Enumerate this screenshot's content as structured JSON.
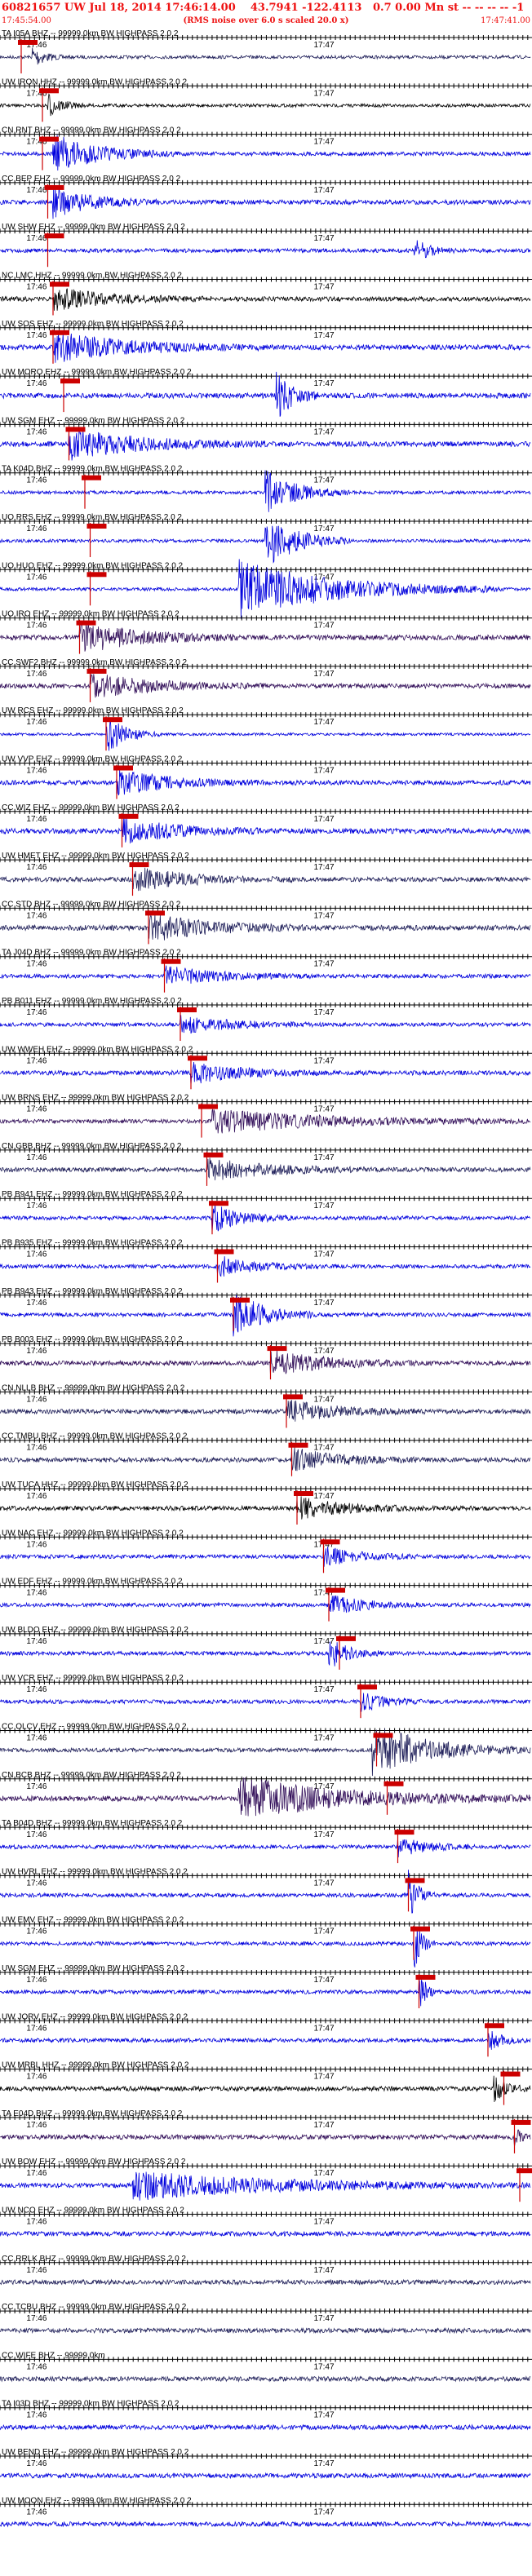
{
  "header": {
    "title": "60821657 UW Jul 18, 2014 17:46:14.00    43.7941 -122.4113   0.7 0.00 Mn st -- -- -- -- -1",
    "subtitle": "(RMS noise over 6.0 s scaled 20.0 x)",
    "start_time": "17:45:54.00",
    "end_time": "17:47:41.00"
  },
  "tick_labels": {
    "a": "17:46",
    "b": "17:47"
  },
  "colors": {
    "blue": "#0000dd",
    "navy": "#20205a",
    "black": "#000000",
    "purple": "#33105a",
    "pick": "#cc0000",
    "bg": "#ffffff"
  },
  "chart_data": {
    "type": "seismogram",
    "x_range": [
      "17:45:54.00",
      "17:47:41.00"
    ],
    "traces": [
      {
        "label": "TA I05A BHZ -- 99999.0km BW HIGHPASS 2.0 2",
        "color": "navy",
        "amp": 0.5,
        "pick": 0.04,
        "burst": [
          0.06,
          0.12,
          2.0
        ]
      },
      {
        "label": "UW IRON HHZ -- 99999.0km BW HIGHPASS 2.0 2",
        "color": "black",
        "amp": 0.5,
        "pick": 0.08,
        "burst": [
          0.09,
          0.16,
          2.0
        ]
      },
      {
        "label": "CN RNT BHZ -- 99999.0km BW HIGHPASS 2.0 2",
        "color": "blue",
        "amp": 0.6,
        "pick": 0.08,
        "burst": [
          0.1,
          0.34,
          2.5
        ]
      },
      {
        "label": "CC BEP EHZ -- 99999.0km BW HIGHPASS 2.0 2",
        "color": "blue",
        "amp": 0.7,
        "pick": 0.09,
        "burst": [
          0.1,
          0.3,
          1.6
        ]
      },
      {
        "label": "UW SHW EHZ -- 99999.0km BW HIGHPASS 2.0 2",
        "color": "blue",
        "amp": 0.6,
        "pick": 0.09,
        "burst": [
          0.78,
          0.86,
          1.6
        ]
      },
      {
        "label": "NC LMC HHZ -- 99999.0km BW HIGHPASS 2.0 2",
        "color": "black",
        "amp": 0.7,
        "pick": 0.1,
        "burst": [
          0.1,
          0.4,
          1.2
        ]
      },
      {
        "label": "UW SOS EHZ -- 99999.0km BW HIGHPASS 2.0 2",
        "color": "blue",
        "amp": 0.8,
        "pick": 0.1,
        "burst": [
          0.1,
          0.5,
          1.4
        ]
      },
      {
        "label": "UW MORO EHZ -- 99999.0km BW HIGHPASS 2.0 2",
        "color": "blue",
        "amp": 0.8,
        "pick": 0.12,
        "burst": [
          0.52,
          0.6,
          2.5
        ]
      },
      {
        "label": "UW SGM EHZ -- 99999.0km BW HIGHPASS 2.0 2",
        "color": "blue",
        "amp": 0.8,
        "pick": 0.13,
        "burst": [
          0.13,
          0.5,
          1.4
        ]
      },
      {
        "label": "TA K04D BHZ -- 99999.0km BW HIGHPASS 2.0 2",
        "color": "blue",
        "amp": 0.5,
        "pick": 0.16,
        "burst": [
          0.5,
          0.66,
          3.5
        ]
      },
      {
        "label": "UO RRS EHZ -- 99999.0km BW HIGHPASS 2.0 2",
        "color": "blue",
        "amp": 0.5,
        "pick": 0.17,
        "burst": [
          0.5,
          0.66,
          4.5
        ]
      },
      {
        "label": "UO HUO EHZ -- 99999.0km BW HIGHPASS 2.0 2",
        "color": "blue",
        "amp": 0.5,
        "pick": 0.17,
        "burst": [
          0.45,
          0.95,
          4.5
        ]
      },
      {
        "label": "UO IRO EHZ -- 99999.0km BW HIGHPASS 2.0 2",
        "color": "purple",
        "amp": 0.8,
        "pick": 0.15,
        "burst": [
          0.15,
          0.45,
          1.5
        ]
      },
      {
        "label": "CC SWF2 BHZ -- 99999.0km BW HIGHPASS 2.0 2",
        "color": "purple",
        "amp": 0.7,
        "pick": 0.17,
        "burst": [
          0.17,
          0.5,
          1.3
        ]
      },
      {
        "label": "UW RCS EHZ -- 99999.0km BW HIGHPASS 2.0 2",
        "color": "blue",
        "amp": 0.4,
        "pick": 0.2,
        "burst": [
          0.2,
          0.3,
          4.0
        ]
      },
      {
        "label": "UW VVP EHZ -- 99999.0km BW HIGHPASS 2.0 2",
        "color": "blue",
        "amp": 0.7,
        "pick": 0.22,
        "burst": [
          0.22,
          0.5,
          1.4
        ]
      },
      {
        "label": "CC WIZ EHZ -- 99999.0km BW HIGHPASS 2.0 2",
        "color": "blue",
        "amp": 0.8,
        "pick": 0.23,
        "burst": [
          0.23,
          0.5,
          1.3
        ]
      },
      {
        "label": "UW HMET EHZ -- 99999.0km BW HIGHPASS 2.0 2",
        "color": "navy",
        "amp": 0.7,
        "pick": 0.25,
        "burst": [
          0.25,
          0.55,
          1.3
        ]
      },
      {
        "label": "CC STD BHZ -- 99999.0km BW HIGHPASS 2.0 2",
        "color": "navy",
        "amp": 0.8,
        "pick": 0.28,
        "burst": [
          0.28,
          0.6,
          1.3
        ]
      },
      {
        "label": "TA J04D BHZ -- 99999.0km BW HIGHPASS 2.0 2",
        "color": "blue",
        "amp": 0.6,
        "pick": 0.31,
        "burst": [
          0.31,
          0.6,
          1.2
        ]
      },
      {
        "label": "PB B011 EHZ -- 99999.0km BW HIGHPASS 2.0 2",
        "color": "blue",
        "amp": 0.6,
        "pick": 0.34,
        "burst": [
          0.34,
          0.6,
          1.2
        ]
      },
      {
        "label": "UW WWEH EHZ -- 99999.0km BW HIGHPASS 2.0 2",
        "color": "blue",
        "amp": 0.7,
        "pick": 0.36,
        "burst": [
          0.36,
          0.6,
          1.2
        ]
      },
      {
        "label": "UW BRNS EHZ -- 99999.0km BW HIGHPASS 2.0 2",
        "color": "purple",
        "amp": 0.6,
        "pick": 0.38,
        "burst": [
          0.4,
          1.0,
          1.5
        ]
      },
      {
        "label": "CN GBB BHZ -- 99999.0km BW HIGHPASS 2.0 2",
        "color": "navy",
        "amp": 0.7,
        "pick": 0.39,
        "burst": [
          0.39,
          0.7,
          1.2
        ]
      },
      {
        "label": "PB B941 EHZ -- 99999.0km BW HIGHPASS 2.0 2",
        "color": "blue",
        "amp": 0.6,
        "pick": 0.4,
        "burst": [
          0.4,
          0.55,
          1.8
        ]
      },
      {
        "label": "PB B935 EHZ -- 99999.0km BW HIGHPASS 2.0 2",
        "color": "blue",
        "amp": 0.6,
        "pick": 0.41,
        "burst": [
          0.41,
          0.6,
          1.3
        ]
      },
      {
        "label": "PB B943 EHZ -- 99999.0km BW HIGHPASS 2.0 2",
        "color": "blue",
        "amp": 0.6,
        "pick": 0.44,
        "burst": [
          0.44,
          0.6,
          3.0
        ]
      },
      {
        "label": "PB B003 EHZ -- 99999.0km BW HIGHPASS 2.0 2",
        "color": "purple",
        "amp": 0.7,
        "pick": 0.51,
        "burst": [
          0.51,
          0.8,
          1.3
        ]
      },
      {
        "label": "CN NLLB BHZ -- 99999.0km BW HIGHPASS 2.0 2",
        "color": "navy",
        "amp": 0.7,
        "pick": 0.54,
        "burst": [
          0.54,
          0.8,
          1.2
        ]
      },
      {
        "label": "CC TMBU BHZ -- 99999.0km BW HIGHPASS 2.0 2",
        "color": "navy",
        "amp": 0.7,
        "pick": 0.55,
        "burst": [
          0.55,
          0.8,
          1.2
        ]
      },
      {
        "label": "UW TUCA HHZ -- 99999.0km BW HIGHPASS 2.0 2",
        "color": "black",
        "amp": 0.7,
        "pick": 0.56,
        "burst": [
          0.56,
          0.8,
          1.2
        ]
      },
      {
        "label": "UW NAC EHZ -- 99999.0km BW HIGHPASS 2.0 2",
        "color": "blue",
        "amp": 0.6,
        "pick": 0.61,
        "burst": [
          0.61,
          0.8,
          1.2
        ]
      },
      {
        "label": "UW EDF EHZ -- 99999.0km BW HIGHPASS 2.0 2",
        "color": "blue",
        "amp": 0.6,
        "pick": 0.62,
        "burst": [
          0.62,
          0.8,
          1.3
        ]
      },
      {
        "label": "UW BLDO EHZ -- 99999.0km BW HIGHPASS 2.0 2",
        "color": "blue",
        "amp": 0.6,
        "pick": 0.64,
        "burst": [
          0.62,
          0.72,
          2.0
        ]
      },
      {
        "label": "UW VCR EHZ -- 99999.0km BW HIGHPASS 2.0 2",
        "color": "blue",
        "amp": 0.6,
        "pick": 0.68,
        "burst": [
          0.68,
          0.8,
          1.3
        ]
      },
      {
        "label": "CC OLCV EHZ -- 99999.0km BW HIGHPASS 2.0 2",
        "color": "navy",
        "amp": 0.6,
        "pick": 0.71,
        "burst": [
          0.7,
          1.0,
          3.5
        ]
      },
      {
        "label": "CN BCB BHZ -- 99999.0km BW HIGHPASS 2.0 2",
        "color": "purple",
        "amp": 0.8,
        "pick": 0.73,
        "burst": [
          0.45,
          1.0,
          2.0
        ]
      },
      {
        "label": "TA B04D BHZ -- 99999.0km BW HIGHPASS 2.0 2",
        "color": "blue",
        "amp": 0.6,
        "pick": 0.75,
        "burst": [
          0.75,
          0.9,
          1.2
        ]
      },
      {
        "label": "UW HVRL EHZ -- 99999.0km BW HIGHPASS 2.0 2",
        "color": "blue",
        "amp": 0.6,
        "pick": 0.77,
        "burst": [
          0.77,
          0.82,
          3.5
        ]
      },
      {
        "label": "UW EMV EHZ -- 99999.0km BW HIGHPASS 2.0 2",
        "color": "blue",
        "amp": 0.6,
        "pick": 0.78,
        "burst": [
          0.78,
          0.82,
          3.5
        ]
      },
      {
        "label": "UW SGM EHZ -- 99999.0km BW HIGHPASS 2.0 2",
        "color": "blue",
        "amp": 0.6,
        "pick": 0.79,
        "burst": [
          0.79,
          0.82,
          3.5
        ]
      },
      {
        "label": "UW JORV EHZ -- 99999.0km BW HIGHPASS 2.0 2",
        "color": "blue",
        "amp": 0.6,
        "pick": 0.92,
        "burst": [
          0.92,
          1.0,
          1.3
        ]
      },
      {
        "label": "UW MRBL HHZ -- 99999.0km BW HIGHPASS 2.0 2",
        "color": "black",
        "amp": 0.7,
        "pick": 0.95,
        "burst": [
          0.93,
          1.0,
          1.4
        ]
      },
      {
        "label": "TA E04D BHZ -- 99999.0km BW HIGHPASS 2.0 2",
        "color": "purple",
        "amp": 0.7,
        "pick": 0.97,
        "burst": [
          0.97,
          1.0,
          1.2
        ]
      },
      {
        "label": "UW BOW EHZ -- 99999.0km BW HIGHPASS 2.0 2",
        "color": "blue",
        "amp": 0.7,
        "pick": 0.98,
        "burst": [
          0.25,
          1.0,
          1.5
        ]
      },
      {
        "label": "UW NCO EHZ -- 99999.0km BW HIGHPASS 2.0 2",
        "color": "blue",
        "amp": 0.7,
        "pick": null,
        "burst": null
      },
      {
        "label": "CC RRLK BHZ -- 99999.0km BW HIGHPASS 2.0 2",
        "color": "navy",
        "amp": 0.7,
        "pick": null,
        "burst": null
      },
      {
        "label": "CC TCBU BHZ -- 99999.0km BW HIGHPASS 2.0 2",
        "color": "navy",
        "amp": 0.7,
        "pick": null,
        "burst": null
      },
      {
        "label": "CC WIFE BHZ -- 99999.0km",
        "color": "navy",
        "amp": 0.7,
        "pick": null,
        "burst": null
      },
      {
        "label": "TA I03D BHZ -- 99999.0km BW HIGHPASS 2.0 2",
        "color": "blue",
        "amp": 0.7,
        "pick": null,
        "burst": null
      },
      {
        "label": "UW BEND EHZ -- 99999.0km BW HIGHPASS 2.0 2",
        "color": "blue",
        "amp": 0.7,
        "pick": null,
        "burst": null
      },
      {
        "label": "UW MOON EHZ -- 99999.0km BW HIGHPASS 2.0 2",
        "color": "blue",
        "amp": 0.7,
        "pick": null,
        "burst": null
      }
    ]
  }
}
